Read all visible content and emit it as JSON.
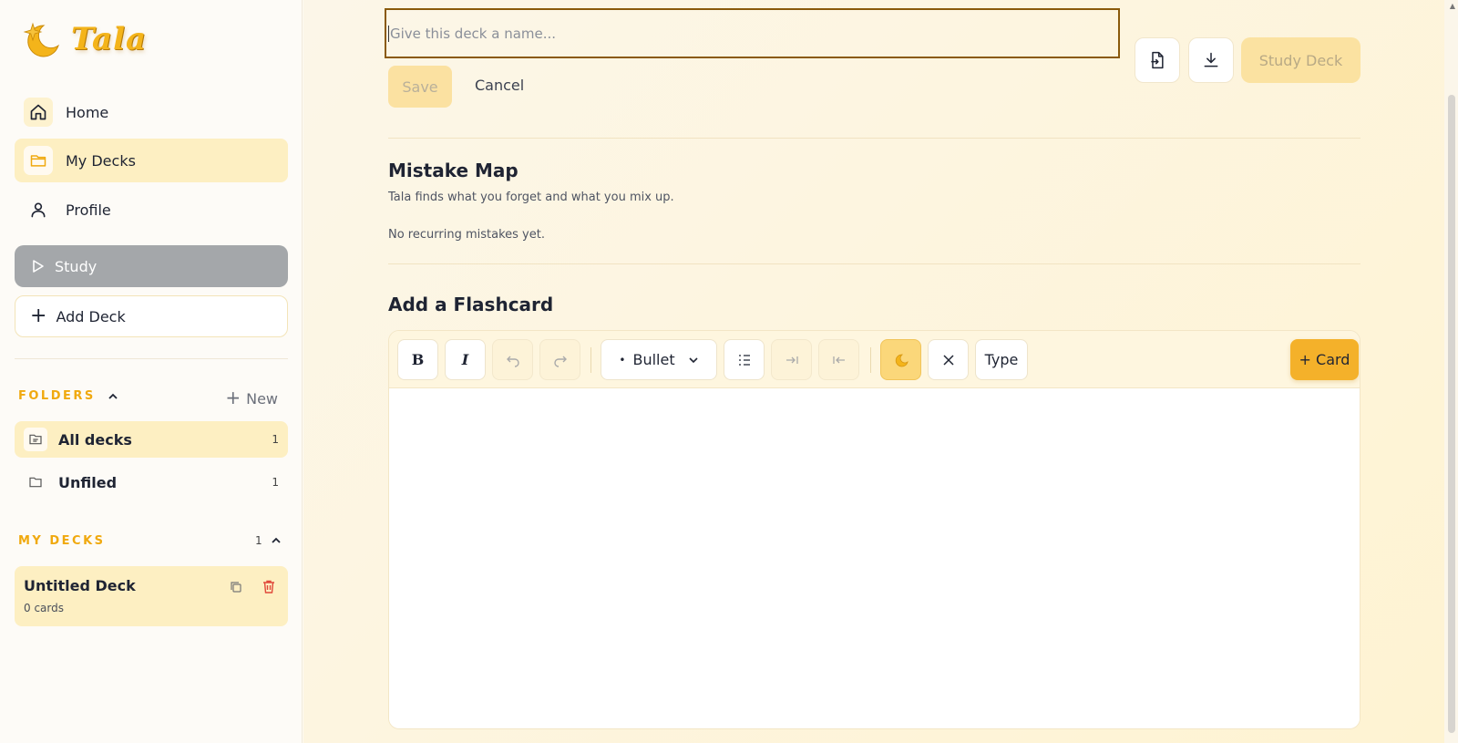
{
  "app": {
    "name": "Tala"
  },
  "sidebar": {
    "nav": [
      {
        "label": "Home",
        "icon": "home-icon"
      },
      {
        "label": "My Decks",
        "icon": "folder-icon",
        "active": true
      },
      {
        "label": "Profile",
        "icon": "user-icon"
      }
    ],
    "study_label": "Study",
    "add_deck_label": "Add Deck",
    "folders": {
      "heading": "FOLDERS",
      "new_label": "New",
      "items": [
        {
          "label": "All decks",
          "count": "1",
          "active": true
        },
        {
          "label": "Unfiled",
          "count": "1"
        }
      ]
    },
    "my_decks": {
      "heading": "MY DECKS",
      "count": "1",
      "items": [
        {
          "title": "Untitled Deck",
          "subtitle": "0 cards"
        }
      ]
    }
  },
  "header": {
    "name_placeholder": "Give this deck a name...",
    "save_label": "Save",
    "cancel_label": "Cancel",
    "study_deck_label": "Study Deck"
  },
  "mistake_map": {
    "title": "Mistake Map",
    "subtitle": "Tala finds what you forget and what you mix up.",
    "empty": "No recurring mistakes yet."
  },
  "flashcard": {
    "title": "Add a Flashcard",
    "list_style": "Bullet",
    "type_label": "Type",
    "add_card_label": "+ Card"
  },
  "colors": {
    "accent": "#f4b12a",
    "brand": "#f4b41a",
    "active_bg": "#fdefc2",
    "danger": "#e0483a"
  }
}
